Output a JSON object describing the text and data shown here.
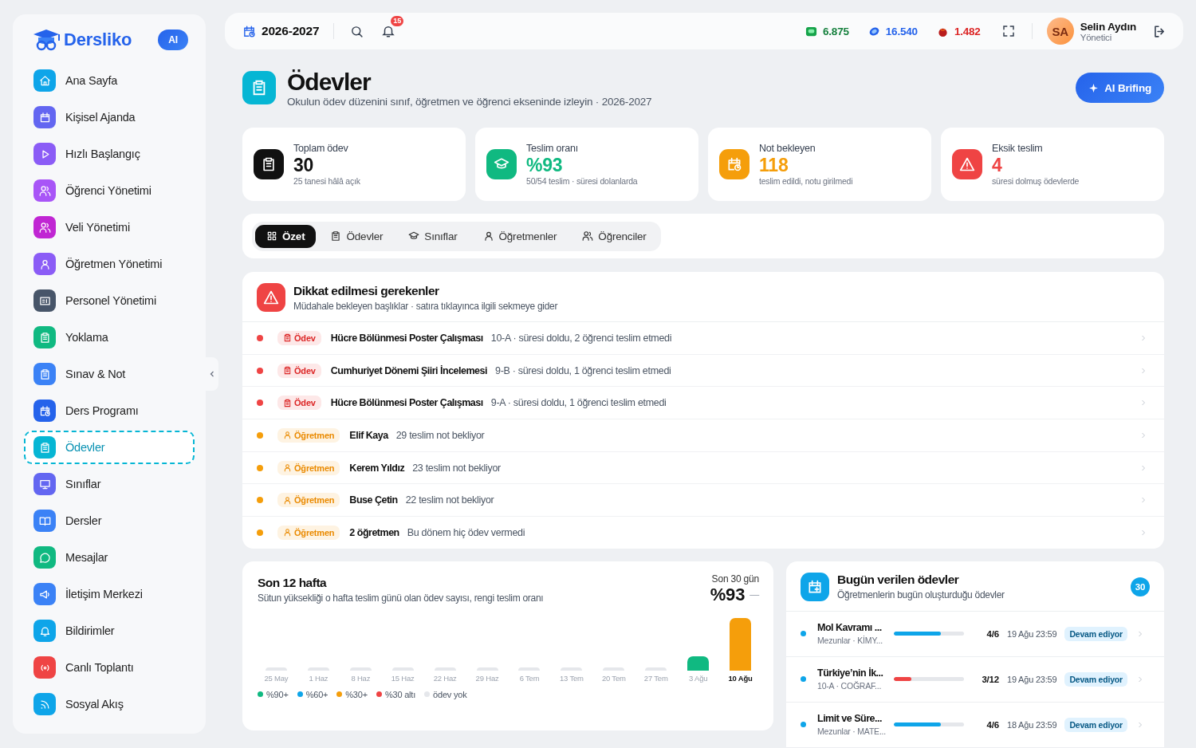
{
  "sidebar": {
    "logo": "Dersliko",
    "ai_badge": "AI",
    "items": [
      {
        "label": "Ana Sayfa",
        "color": "#0ea5e9",
        "selected": false
      },
      {
        "label": "Kişisel Ajanda",
        "color": "#6366f1",
        "selected": false
      },
      {
        "label": "Hızlı Başlangıç",
        "color": "#8b5cf6",
        "selected": false
      },
      {
        "label": "Öğrenci Yönetimi",
        "color": "#a855f7",
        "selected": false
      },
      {
        "label": "Veli Yönetimi",
        "color": "#c026d3",
        "selected": false
      },
      {
        "label": "Öğretmen Yönetimi",
        "color": "#8b5cf6",
        "selected": false
      },
      {
        "label": "Personel Yönetimi",
        "color": "#475569",
        "selected": false
      },
      {
        "label": "Yoklama",
        "color": "#10b981",
        "selected": false
      },
      {
        "label": "Sınav & Not",
        "color": "#3b82f6",
        "selected": false
      },
      {
        "label": "Ders Programı",
        "color": "#2563eb",
        "selected": false
      },
      {
        "label": "Ödevler",
        "color": "#06b6d4",
        "selected": true
      },
      {
        "label": "Sınıflar",
        "color": "#6366f1",
        "selected": false
      },
      {
        "label": "Dersler",
        "color": "#3b82f6",
        "selected": false
      },
      {
        "label": "Mesajlar",
        "color": "#10b981",
        "selected": false
      },
      {
        "label": "İletişim Merkezi",
        "color": "#3b82f6",
        "selected": false
      },
      {
        "label": "Bildirimler",
        "color": "#0ea5e9",
        "selected": false
      },
      {
        "label": "Canlı Toplantı",
        "color": "#ef4444",
        "selected": false
      },
      {
        "label": "Sosyal Akış",
        "color": "#0ea5e9",
        "selected": false
      }
    ]
  },
  "topbar": {
    "year": "2026-2027",
    "notifications": "15",
    "stats": [
      {
        "value": "6.875",
        "color": "#15803d"
      },
      {
        "value": "16.540",
        "color": "#2563eb"
      },
      {
        "value": "1.482",
        "color": "#dc2626"
      }
    ],
    "user": {
      "initials": "SA",
      "name": "Selin Aydın",
      "role": "Yönetici"
    }
  },
  "header": {
    "title": "Ödevler",
    "subtitle": "Okulun ödev düzenini sınıf, öğretmen ve öğrenci ekseninde izleyin · 2026-2027",
    "ai_button": "AI Brifing"
  },
  "stat_cards": [
    {
      "label": "Toplam ödev",
      "value": "30",
      "note": "25 tanesi hâlâ açık",
      "color": "#111111"
    },
    {
      "label": "Teslim oranı",
      "value": "%93",
      "note": "50/54 teslim · süresi dolanlarda",
      "color": "#10b981"
    },
    {
      "label": "Not bekleyen",
      "value": "118",
      "note": "teslim edildi, notu girilmedi",
      "color": "#f59e0b"
    },
    {
      "label": "Eksik teslim",
      "value": "4",
      "note": "süresi dolmuş ödevlerde",
      "color": "#ef4444"
    }
  ],
  "tabs": [
    {
      "label": "Özet",
      "selected": true
    },
    {
      "label": "Ödevler",
      "selected": false
    },
    {
      "label": "Sınıflar",
      "selected": false
    },
    {
      "label": "Öğretmenler",
      "selected": false
    },
    {
      "label": "Öğrenciler",
      "selected": false
    }
  ],
  "attention": {
    "title": "Dikkat edilmesi gerekenler",
    "subtitle": "Müdahale bekleyen başlıklar · satıra tıklayınca ilgili sekmeye gider",
    "rows": [
      {
        "kind": "assignment",
        "tag": "Ödev",
        "title": "Hücre Bölünmesi Poster Çalışması",
        "detail": "10-A · süresi doldu, 2 öğrenci teslim etmedi"
      },
      {
        "kind": "assignment",
        "tag": "Ödev",
        "title": "Cumhuriyet Dönemi Şiiri İncelemesi",
        "detail": "9-B · süresi doldu, 1 öğrenci teslim etmedi"
      },
      {
        "kind": "assignment",
        "tag": "Ödev",
        "title": "Hücre Bölünmesi Poster Çalışması",
        "detail": "9-A · süresi doldu, 1 öğrenci teslim etmedi"
      },
      {
        "kind": "teacher",
        "tag": "Öğretmen",
        "title": "Elif Kaya",
        "detail": "29 teslim not bekliyor"
      },
      {
        "kind": "teacher",
        "tag": "Öğretmen",
        "title": "Kerem Yıldız",
        "detail": "23 teslim not bekliyor"
      },
      {
        "kind": "teacher",
        "tag": "Öğretmen",
        "title": "Buse Çetin",
        "detail": "22 teslim not bekliyor"
      },
      {
        "kind": "teacher",
        "tag": "Öğretmen",
        "title": "2 öğretmen",
        "detail": "Bu dönem hiç ödev vermedi"
      }
    ]
  },
  "weeks_panel": {
    "title": "Son 12 hafta",
    "subtitle": "Sütun yüksekliği o hafta teslim günü olan ödev sayısı, rengi teslim oranı",
    "period_label": "Son 30 gün",
    "period_value": "%93",
    "trend": "—",
    "weeks": [
      {
        "label": "25 May",
        "color": "#e5e7eb",
        "current": false
      },
      {
        "label": "1 Haz",
        "color": "#e5e7eb",
        "current": false
      },
      {
        "label": "8 Haz",
        "color": "#e5e7eb",
        "current": false
      },
      {
        "label": "15 Haz",
        "color": "#e5e7eb",
        "current": false
      },
      {
        "label": "22 Haz",
        "color": "#e5e7eb",
        "current": false
      },
      {
        "label": "29 Haz",
        "color": "#e5e7eb",
        "current": false
      },
      {
        "label": "6 Tem",
        "color": "#e5e7eb",
        "current": false
      },
      {
        "label": "13 Tem",
        "color": "#e5e7eb",
        "current": false
      },
      {
        "label": "20 Tem",
        "color": "#e5e7eb",
        "current": false
      },
      {
        "label": "27 Tem",
        "color": "#e5e7eb",
        "current": false
      },
      {
        "label": "3 Ağu",
        "color": "#10b981",
        "current": false
      },
      {
        "label": "10 Ağu",
        "color": "#f59e0b",
        "current": true
      }
    ],
    "legend": [
      {
        "label": "%90+",
        "color": "#10b981"
      },
      {
        "label": "%60+",
        "color": "#0ea5e9"
      },
      {
        "label": "%30+",
        "color": "#f59e0b"
      },
      {
        "label": "%30 altı",
        "color": "#ef4444"
      },
      {
        "label": "ödev yok",
        "color": "#e5e7eb"
      }
    ]
  },
  "today": {
    "title": "Bugün verilen ödevler",
    "subtitle": "Öğretmenlerin bugün oluşturduğu ödevler",
    "count": "30",
    "rows": [
      {
        "title": "Mol Kavramı ...",
        "meta": "Mezunlar · KİMY...",
        "level": 0.67,
        "color": "#0ea5e9",
        "ratio": "4/6",
        "due": "19 Ağu 23:59",
        "status": "Devam ediyor"
      },
      {
        "title": "Türkiye’nin İk...",
        "meta": "10-A · COĞRAF...",
        "level": 0.25,
        "color": "#ef4444",
        "ratio": "3/12",
        "due": "19 Ağu 23:59",
        "status": "Devam ediyor"
      },
      {
        "title": "Limit ve Süre...",
        "meta": "Mezunlar · MATE...",
        "level": 0.67,
        "color": "#0ea5e9",
        "ratio": "4/6",
        "due": "18 Ağu 23:59",
        "status": "Devam ediyor"
      }
    ]
  }
}
